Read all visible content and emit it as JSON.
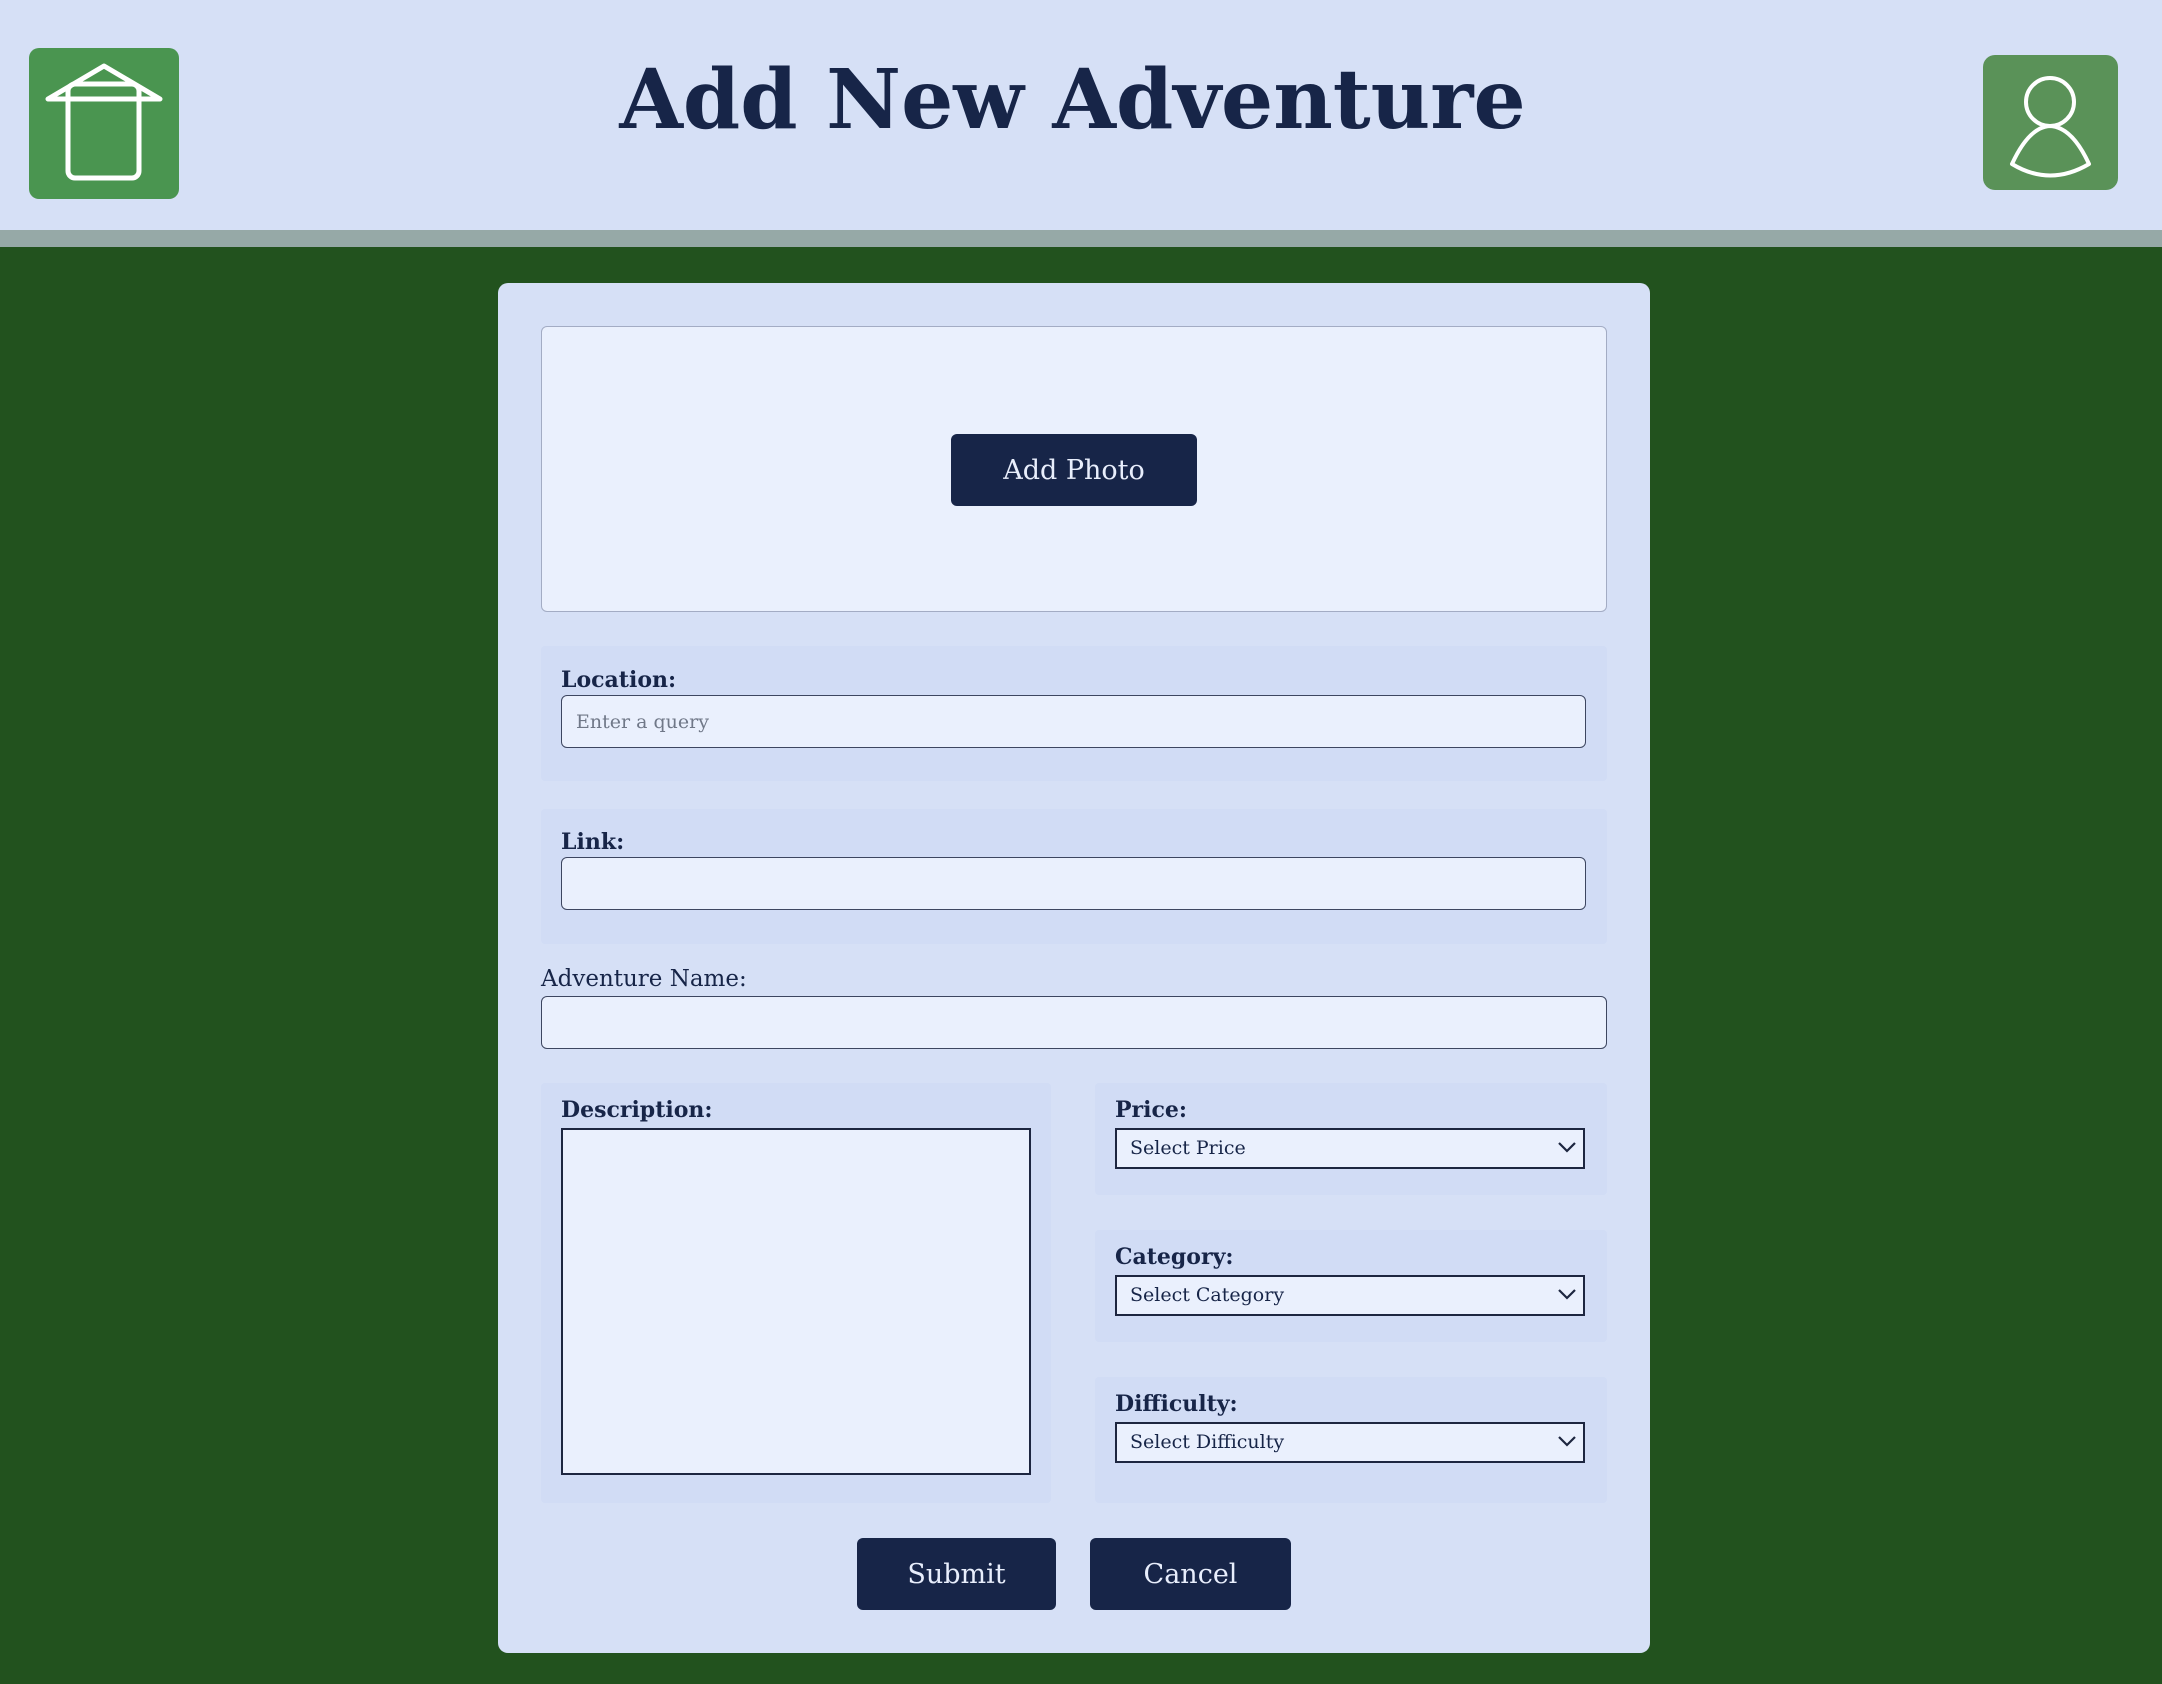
{
  "header": {
    "title": "Add New Adventure",
    "home_icon": "home-icon",
    "profile_icon": "user-icon"
  },
  "colors": {
    "background": "#22521e",
    "header_bg": "#d6e0f6",
    "card_bg": "#d6e0f6",
    "primary_navy": "#172548",
    "home_button": "#4a9550",
    "profile_button": "#5a9258"
  },
  "form": {
    "add_photo_label": "Add Photo",
    "location": {
      "label": "Location:",
      "placeholder": "Enter a query",
      "value": ""
    },
    "link": {
      "label": "Link:",
      "value": ""
    },
    "adventure_name": {
      "label": "Adventure Name:",
      "value": ""
    },
    "description": {
      "label": "Description:",
      "value": ""
    },
    "price": {
      "label": "Price:",
      "selected": "Select Price"
    },
    "category": {
      "label": "Category:",
      "selected": "Select Category"
    },
    "difficulty": {
      "label": "Difficulty:",
      "selected": "Select Difficulty"
    },
    "submit_label": "Submit",
    "cancel_label": "Cancel"
  }
}
